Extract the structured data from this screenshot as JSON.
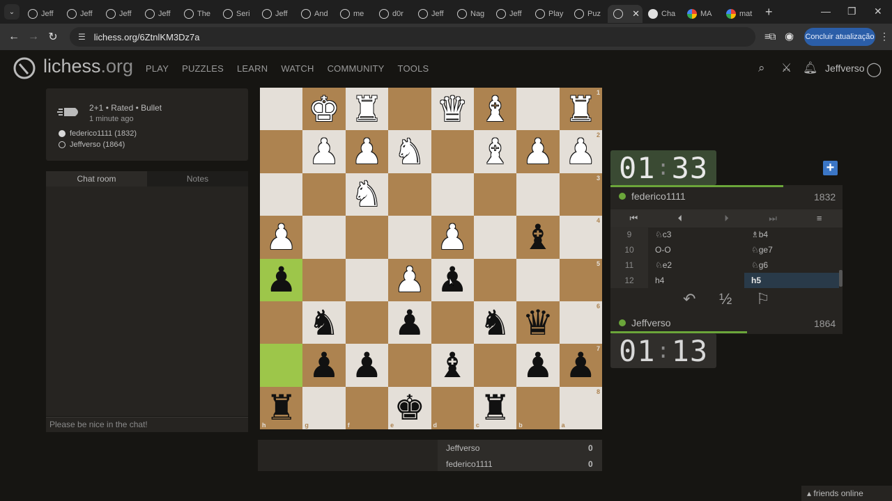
{
  "browser": {
    "tabs": [
      {
        "label": "Jeff",
        "icon": "lichess-icon"
      },
      {
        "label": "Jeff",
        "icon": "lichess-icon"
      },
      {
        "label": "Jeff",
        "icon": "lichess-icon"
      },
      {
        "label": "Jeff",
        "icon": "lichess-icon"
      },
      {
        "label": "The",
        "icon": "lichess-icon"
      },
      {
        "label": "Seri",
        "icon": "lichess-icon"
      },
      {
        "label": "Jeff",
        "icon": "lichess-icon"
      },
      {
        "label": "And",
        "icon": "lichess-icon"
      },
      {
        "label": "me",
        "icon": "lichess-icon"
      },
      {
        "label": "d0r",
        "icon": "lichess-icon"
      },
      {
        "label": "Jeff",
        "icon": "lichess-icon"
      },
      {
        "label": "Nag",
        "icon": "lichess-icon"
      },
      {
        "label": "Jeff",
        "icon": "lichess-icon"
      },
      {
        "label": "Play",
        "icon": "lichess-icon"
      },
      {
        "label": "Puz",
        "icon": "lichess-icon"
      },
      {
        "label": "",
        "icon": "lichess-icon",
        "active": true
      },
      {
        "label": "Cha",
        "icon": "openai-icon"
      },
      {
        "label": "MA",
        "icon": "google-icon"
      },
      {
        "label": "mat",
        "icon": "google-icon"
      }
    ],
    "url": "lichess.org/6ZtnlKM3Dz7a",
    "update_button": "Concluir atualização"
  },
  "site": {
    "logo": "lichess",
    "logo_tld": ".org",
    "nav": [
      "PLAY",
      "PUZZLES",
      "LEARN",
      "WATCH",
      "COMMUNITY",
      "TOOLS"
    ],
    "username": "Jeffverso"
  },
  "game_info": {
    "type": "2+1 • Rated • Bullet",
    "time_ago": "1 minute ago",
    "white_player": "federico1111 (1832)",
    "black_player": "Jeffverso (1864)"
  },
  "chat": {
    "tab_chat": "Chat room",
    "tab_notes": "Notes",
    "placeholder": "Please be nice in the chat!"
  },
  "board": {
    "orientation": "black",
    "ranks": [
      "1",
      "2",
      "3",
      "4",
      "5",
      "6",
      "7",
      "8"
    ],
    "files": [
      "h",
      "g",
      "f",
      "e",
      "d",
      "c",
      "b",
      "a"
    ],
    "squares": [
      [
        "",
        "wK",
        "wR",
        "",
        "wQ",
        "wB",
        "",
        "wR"
      ],
      [
        "",
        "wP",
        "wP",
        "wN",
        "",
        "wB",
        "wP",
        "wP"
      ],
      [
        "",
        "",
        "wN",
        "",
        "",
        "",
        "",
        ""
      ],
      [
        "wP",
        "",
        "",
        "",
        "wP",
        "",
        "bB",
        ""
      ],
      [
        "bP",
        "",
        "",
        "wP",
        "bP",
        "",
        "",
        ""
      ],
      [
        "",
        "bN",
        "",
        "bP",
        "",
        "bN",
        "bQ",
        ""
      ],
      [
        "",
        "bP",
        "bP",
        "",
        "bB",
        "",
        "bP",
        "bP"
      ],
      [
        "bR",
        "",
        "",
        "bK",
        "",
        "bR",
        "",
        ""
      ]
    ],
    "highlighted": [
      [
        4,
        0
      ],
      [
        6,
        0
      ]
    ]
  },
  "material": {
    "top_name": "Jeffverso",
    "top_score": "0",
    "bottom_name": "federico1111",
    "bottom_score": "0"
  },
  "clocks": {
    "opponent_min": "01",
    "opponent_sec": "33",
    "player_min": "01",
    "player_sec": "13"
  },
  "opponent": {
    "name": "federico1111",
    "rating": "1832"
  },
  "player": {
    "name": "Jeffverso",
    "rating": "1864"
  },
  "moves": [
    {
      "num": "9",
      "white": "♘c3",
      "black": "♗b4"
    },
    {
      "num": "10",
      "white": "O-O",
      "black": "♘ge7"
    },
    {
      "num": "11",
      "white": "♘e2",
      "black": "♘g6"
    },
    {
      "num": "12",
      "white": "h4",
      "black": "h5",
      "active": true
    }
  ],
  "actions": {
    "draw": "½"
  },
  "footer": {
    "friends": "friends online"
  },
  "colors": {
    "accent_green": "#6ba63a",
    "light_square": "#e4dfd8",
    "dark_square": "#ad8350",
    "highlight": "#9dc64a",
    "blue": "#3b76c6"
  }
}
